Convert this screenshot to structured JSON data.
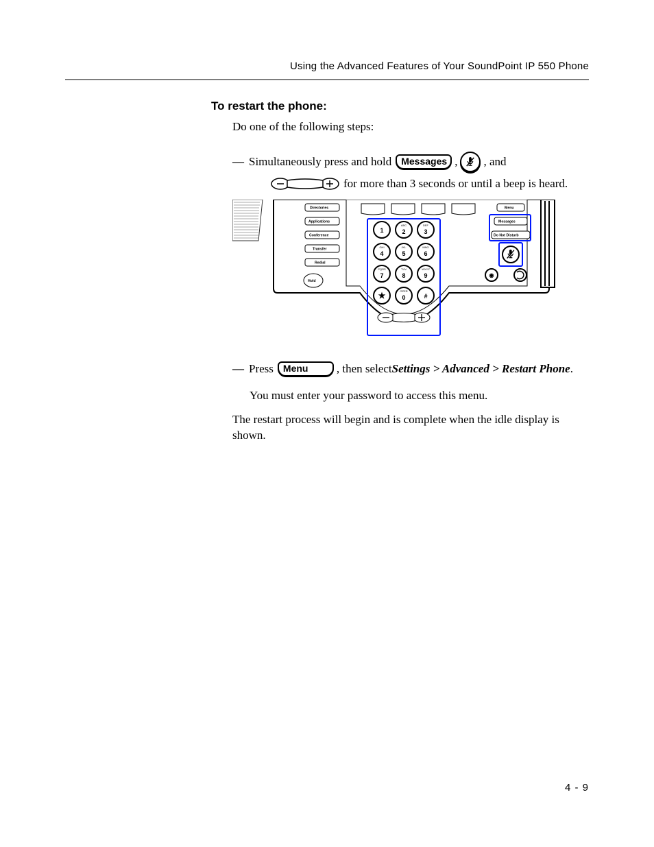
{
  "header": {
    "running_title": "Using the Advanced Features of Your SoundPoint IP 550 Phone"
  },
  "section": {
    "title": "To restart the phone:"
  },
  "body": {
    "intro": "Do one of the following steps:",
    "step1_pre": "Simultaneously press and hold ",
    "step1_key1": "Messages",
    "step1_mid1": ", ",
    "step1_mid2": ", and",
    "step1_line2_tail": " for more than 3 seconds or until a beep is heard.",
    "step2_pre": "Press ",
    "step2_key": "Menu",
    "step2_mid": ", then select ",
    "step2_path": "Settings > Advanced > Restart Phone",
    "step2_end": ".",
    "password_note": "You must enter your password to access this menu.",
    "closing": "The restart process will begin and is complete when the idle display is shown."
  },
  "phone_labels": {
    "left": [
      "Directories",
      "Applications",
      "Conference",
      "Transfer",
      "Redial"
    ],
    "hold": "Hold",
    "right_top": "Menu",
    "right_mid": "Messages",
    "right_dnd": "Do Not Disturb"
  },
  "footer": {
    "page_num": "4 - 9"
  }
}
